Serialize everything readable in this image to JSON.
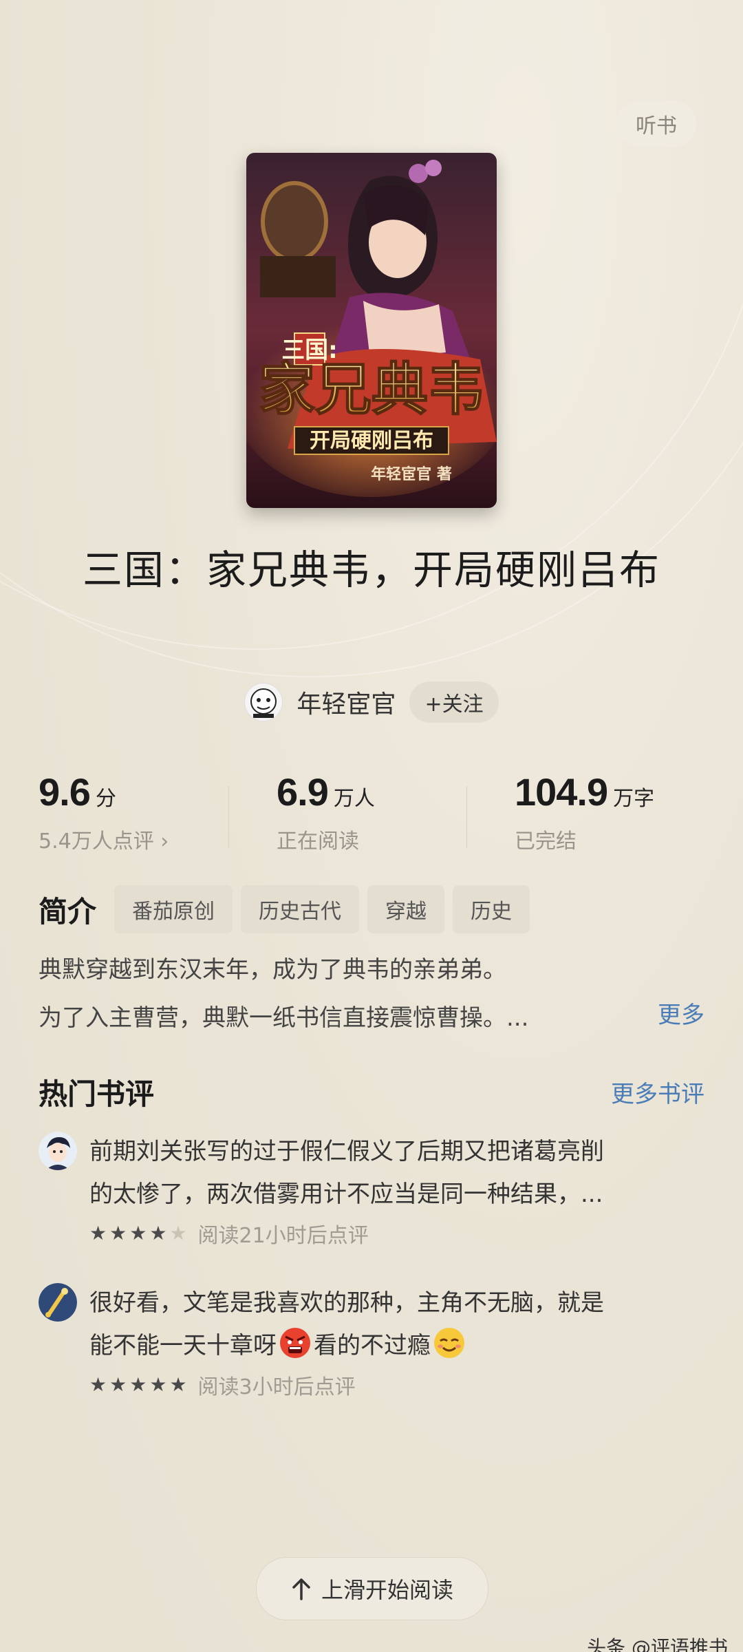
{
  "header": {
    "listen_label": "听书"
  },
  "cover": {
    "title_line1": "三国:",
    "title_big": "家兄典韦",
    "title_sub": "开局硬刚吕布",
    "author_line": "年轻宦官 著"
  },
  "book": {
    "title": "三国：家兄典韦，开局硬刚吕布"
  },
  "author": {
    "name": "年轻宦官",
    "follow_label": "+关注"
  },
  "stats": {
    "rating": {
      "value": "9.6",
      "unit": "分",
      "sub": "5.4万人点评 ›"
    },
    "readers": {
      "value": "6.9",
      "unit": "万人",
      "sub": "正在阅读"
    },
    "words": {
      "value": "104.9",
      "unit": "万字",
      "sub": "已完结"
    }
  },
  "intro": {
    "heading": "简介",
    "tags": [
      "番茄原创",
      "历史古代",
      "穿越",
      "历史"
    ],
    "lines": [
      "典默穿越到东汉末年，成为了典韦的亲弟弟。",
      "为了入主曹营，典默一纸书信直接震惊曹操。..."
    ],
    "more_label": "更多"
  },
  "reviews": {
    "title": "热门书评",
    "more_label": "更多书评",
    "items": [
      {
        "lines": [
          "前期刘关张写的过于假仁假义了后期又把诸葛亮削",
          "的太惨了，两次借雾用计不应当是同一种结果，..."
        ],
        "stars": 4,
        "time": "阅读21小时后点评"
      },
      {
        "line1": "很好看，文笔是我喜欢的那种，主角不无脑，就是",
        "line2_a": "能不能一天十章呀",
        "line2_b": "看的不过瘾",
        "stars": 5,
        "time": "阅读3小时后点评"
      }
    ]
  },
  "footer": {
    "start_label": "上滑开始阅读",
    "watermark": "头条 @评语推书"
  },
  "icons": {
    "up_arrow": "up-arrow-icon",
    "star": "star-icon",
    "angry_emoji": "angry-emoji-icon",
    "smile_emoji": "smile-emoji-icon"
  }
}
